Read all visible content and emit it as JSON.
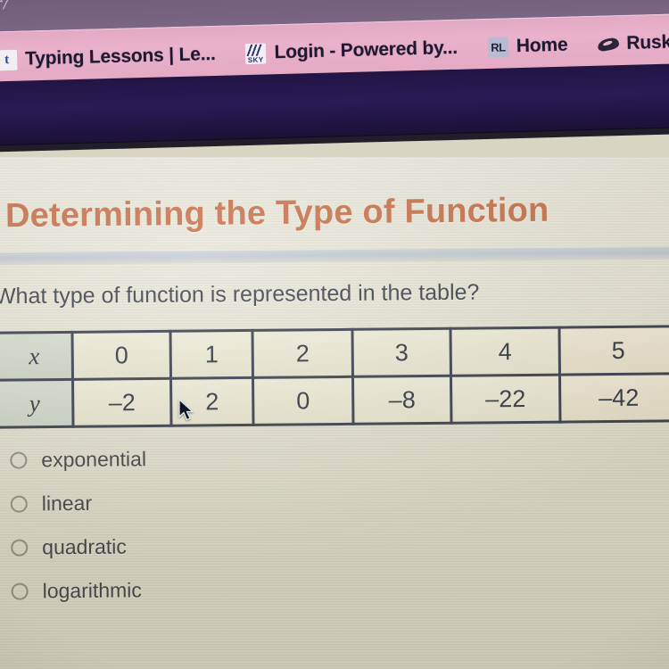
{
  "browser": {
    "url_fragment": "r/",
    "bookmarks": [
      {
        "label": "Typing Lessons | Le...",
        "icon": "letter-t-favicon"
      },
      {
        "label": "Login - Powered by...",
        "icon": "sky-favicon"
      },
      {
        "label": "Home",
        "icon": "rl-favicon"
      },
      {
        "label": "Rusk Ju",
        "icon": "eagle-favicon"
      }
    ]
  },
  "lesson": {
    "title": "Determining the Type of Function",
    "question": "What type of function is represented in the table?"
  },
  "table": {
    "row_labels": [
      "x",
      "y"
    ],
    "x": [
      "0",
      "1",
      "2",
      "3",
      "4",
      "5"
    ],
    "y": [
      "–2",
      "2",
      "0",
      "–8",
      "–22",
      "–42"
    ]
  },
  "options": [
    {
      "label": "exponential",
      "selected": false
    },
    {
      "label": "linear",
      "selected": false
    },
    {
      "label": "quadratic",
      "selected": false
    },
    {
      "label": "logarithmic",
      "selected": false
    }
  ],
  "colors": {
    "title_orange": "#c2673f",
    "bookmark_bar": "#e6accb",
    "dark_band": "#261850",
    "page_bg": "#e7e5d6",
    "table_border": "#2c3243"
  }
}
